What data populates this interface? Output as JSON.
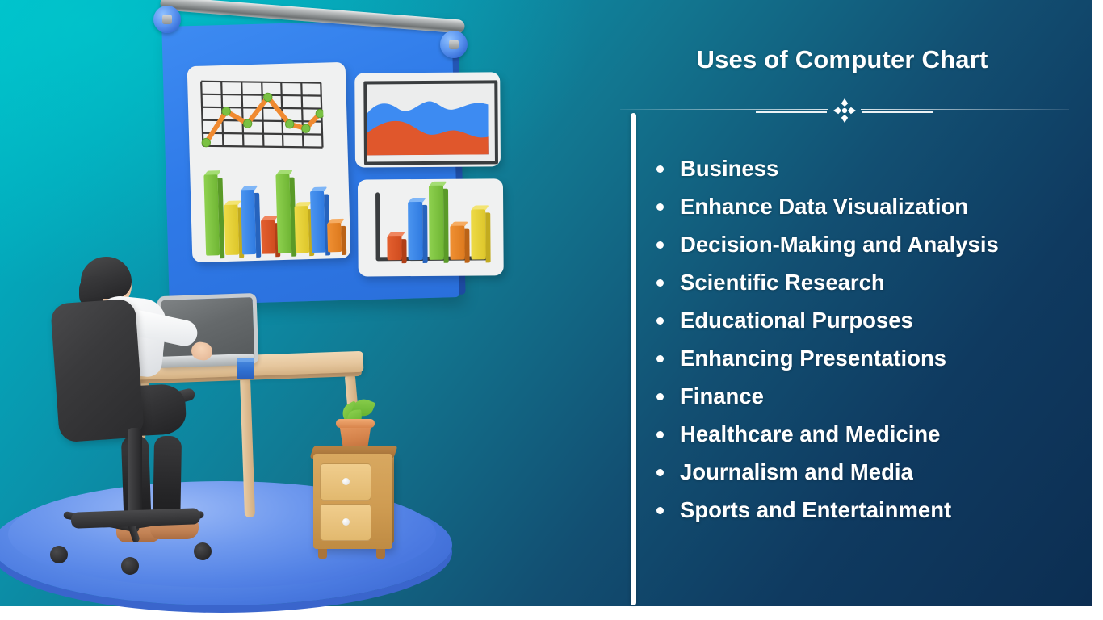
{
  "slide": {
    "title": "Uses of Computer Chart",
    "colors": {
      "bg_top_left": "#00b9c6",
      "bg_bottom_right": "#0c2e52",
      "text": "#ffffff",
      "accent_bar": "#ffffff",
      "board_blue": "#2f7ae8",
      "floor_disc": "#5e8ce8"
    },
    "divider": {
      "ornament_icon": "quatrefoil-ornament"
    },
    "list": [
      {
        "label": "Business"
      },
      {
        "label": "Enhance Data Visualization"
      },
      {
        "label": "Decision-Making and Analysis"
      },
      {
        "label": "Scientific Research"
      },
      {
        "label": "Educational Purposes"
      },
      {
        "label": "Enhancing Presentations"
      },
      {
        "label": "Finance"
      },
      {
        "label": "Healthcare and Medicine"
      },
      {
        "label": "Journalism and Media"
      },
      {
        "label": "Sports and Entertainment"
      }
    ]
  },
  "illustration": {
    "scene_name": "person-at-desk-with-presentation-board",
    "board": {
      "charts": [
        {
          "name": "grid-line-chart",
          "type": "line",
          "line_color": "#f08a30",
          "point_color": "#7ac143",
          "grid": true,
          "grid_cols": 6,
          "grid_rows": 6,
          "x": [
            0,
            1,
            2,
            3,
            4,
            5,
            6
          ],
          "values": [
            5,
            60,
            40,
            80,
            48,
            28,
            46
          ]
        },
        {
          "name": "board-bar-chart",
          "type": "bar",
          "categories": [
            "1",
            "2",
            "3",
            "4",
            "5",
            "6",
            "7",
            "8"
          ],
          "values": [
            100,
            62,
            80,
            42,
            98,
            58,
            76,
            36
          ],
          "colors": [
            "#7ac143",
            "#e8d235",
            "#3d8bf2",
            "#e0572c",
            "#7ac143",
            "#e8d235",
            "#3d8bf2",
            "#ef8a28"
          ]
        },
        {
          "name": "area-chart",
          "type": "area",
          "series": [
            {
              "name": "blue-band",
              "color": "#3d8bf2",
              "values": [
                55,
                70,
                62,
                78,
                66,
                58,
                74,
                70,
                62
              ]
            },
            {
              "name": "orange-band",
              "color": "#e0572c",
              "values": [
                28,
                44,
                50,
                40,
                30,
                26,
                34,
                30,
                24
              ]
            }
          ]
        },
        {
          "name": "axis-bar-chart",
          "type": "bar",
          "categories": [
            "1",
            "2",
            "3",
            "4",
            "5"
          ],
          "values": [
            30,
            72,
            92,
            42,
            62
          ],
          "colors": [
            "#e0572c",
            "#3d8bf2",
            "#7ac143",
            "#ef8a28",
            "#e8d235"
          ]
        }
      ]
    },
    "objects": [
      {
        "name": "laptop"
      },
      {
        "name": "coffee-mug",
        "color": "#2f6fd0"
      },
      {
        "name": "office-chair"
      },
      {
        "name": "wooden-desk"
      },
      {
        "name": "filing-cabinet",
        "drawers": 2
      },
      {
        "name": "potted-plant"
      }
    ]
  }
}
